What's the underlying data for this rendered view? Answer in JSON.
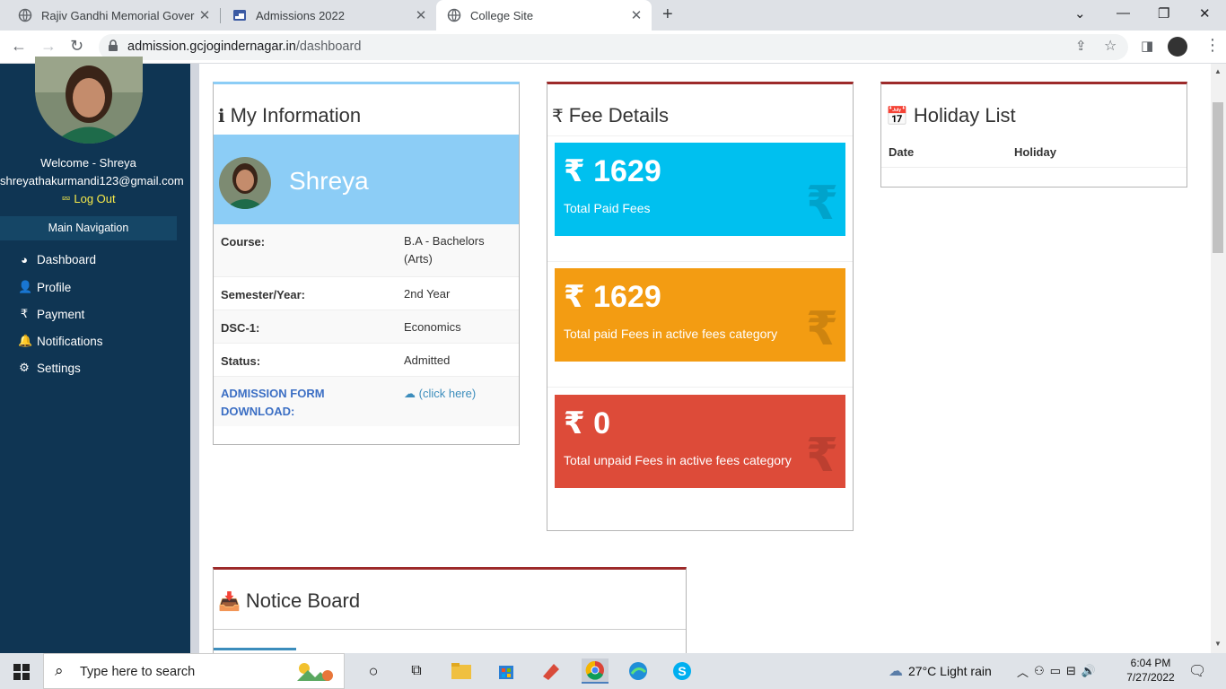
{
  "browser": {
    "tabs": [
      {
        "title": "Rajiv Gandhi Memorial Governme",
        "close": "✕"
      },
      {
        "title": "Admissions 2022",
        "close": "✕"
      },
      {
        "title": "College Site",
        "close": "✕"
      }
    ],
    "new_tab": "+",
    "url_host": "admission.gcjogindernagar.in",
    "url_path": "/dashboard"
  },
  "sidebar": {
    "welcome": "Welcome - Shreya",
    "email": "shreyathakurmandi123@gmail.com",
    "logout": "Log Out",
    "main_navigation": "Main Navigation",
    "items": [
      {
        "label": "Dashboard",
        "icon": "dashboard-icon"
      },
      {
        "label": "Profile",
        "icon": "user-icon"
      },
      {
        "label": "Payment",
        "icon": "rupee-icon"
      },
      {
        "label": "Notifications",
        "icon": "bell-icon"
      },
      {
        "label": "Settings",
        "icon": "gear-icon"
      }
    ]
  },
  "my_info": {
    "title": "My Information",
    "name": "Shreya",
    "rows": [
      {
        "key": "Course:",
        "value": "B.A - Bachelors (Arts)"
      },
      {
        "key": "Semester/Year:",
        "value": "2nd Year"
      },
      {
        "key": "DSC-1:",
        "value": "Economics"
      },
      {
        "key": "Status:",
        "value": "Admitted"
      },
      {
        "key": "ADMISSION FORM DOWNLOAD:",
        "value": "(click here)"
      }
    ]
  },
  "fee_details": {
    "title": "Fee Details",
    "cards": [
      {
        "amount": "₹ 1629",
        "label": "Total Paid Fees",
        "color": "#00c0ef"
      },
      {
        "amount": "₹ 1629",
        "label": "Total paid Fees in active fees category",
        "color": "#f39c12"
      },
      {
        "amount": "₹ 0",
        "label": "Total unpaid Fees in active fees category",
        "color": "#dd4b39"
      }
    ],
    "bg_symbol": "₹"
  },
  "holiday_list": {
    "title": "Holiday List",
    "columns": [
      "Date",
      "Holiday"
    ]
  },
  "notice_board": {
    "title": "Notice Board"
  },
  "taskbar": {
    "search_placeholder": "Type here to search",
    "weather": "27°C  Light rain",
    "time": "6:04 PM",
    "date": "7/27/2022"
  },
  "colors": {
    "sidebar_bg": "#0f3553",
    "box_border_accent": "#9d2a2a",
    "banner_bg": "#8ccdf6",
    "link": "#3c8dbc",
    "logout": "#f7ea4a"
  }
}
